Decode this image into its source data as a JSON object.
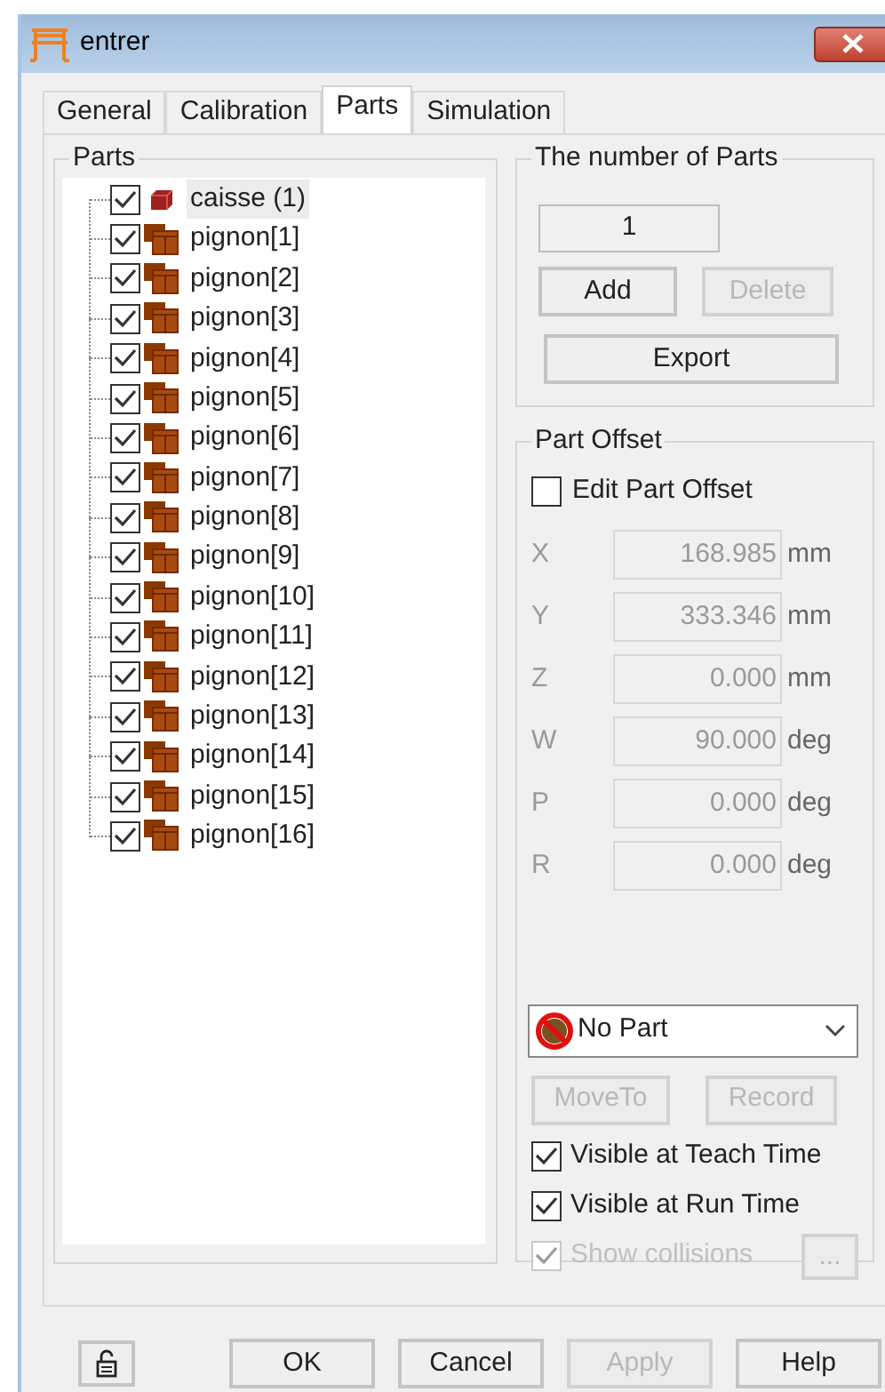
{
  "window": {
    "title": "entrer"
  },
  "tabs": [
    {
      "label": "General",
      "selected": false
    },
    {
      "label": "Calibration",
      "selected": false
    },
    {
      "label": "Parts",
      "selected": true
    },
    {
      "label": "Simulation",
      "selected": false
    }
  ],
  "parts_group": {
    "title": "Parts",
    "items": [
      {
        "label": "caisse (1)",
        "kind": "single",
        "checked": true,
        "selected": true
      },
      {
        "label": "pignon[1]",
        "kind": "multi",
        "checked": true,
        "selected": false
      },
      {
        "label": "pignon[2]",
        "kind": "multi",
        "checked": true,
        "selected": false
      },
      {
        "label": "pignon[3]",
        "kind": "multi",
        "checked": true,
        "selected": false
      },
      {
        "label": "pignon[4]",
        "kind": "multi",
        "checked": true,
        "selected": false
      },
      {
        "label": "pignon[5]",
        "kind": "multi",
        "checked": true,
        "selected": false
      },
      {
        "label": "pignon[6]",
        "kind": "multi",
        "checked": true,
        "selected": false
      },
      {
        "label": "pignon[7]",
        "kind": "multi",
        "checked": true,
        "selected": false
      },
      {
        "label": "pignon[8]",
        "kind": "multi",
        "checked": true,
        "selected": false
      },
      {
        "label": "pignon[9]",
        "kind": "multi",
        "checked": true,
        "selected": false
      },
      {
        "label": "pignon[10]",
        "kind": "multi",
        "checked": true,
        "selected": false
      },
      {
        "label": "pignon[11]",
        "kind": "multi",
        "checked": true,
        "selected": false
      },
      {
        "label": "pignon[12]",
        "kind": "multi",
        "checked": true,
        "selected": false
      },
      {
        "label": "pignon[13]",
        "kind": "multi",
        "checked": true,
        "selected": false
      },
      {
        "label": "pignon[14]",
        "kind": "multi",
        "checked": true,
        "selected": false
      },
      {
        "label": "pignon[15]",
        "kind": "multi",
        "checked": true,
        "selected": false
      },
      {
        "label": "pignon[16]",
        "kind": "multi",
        "checked": true,
        "selected": false
      }
    ]
  },
  "count_group": {
    "title": "The number of Parts",
    "count": "1",
    "add": {
      "label": "Add",
      "disabled": false
    },
    "delete": {
      "label": "Delete",
      "disabled": true
    },
    "export": {
      "label": "Export",
      "disabled": false
    }
  },
  "offset_group": {
    "title": "Part Offset",
    "edit": {
      "label": "Edit Part Offset",
      "checked": false
    },
    "fields": [
      {
        "axis": "X",
        "value": "168.985",
        "unit": "mm"
      },
      {
        "axis": "Y",
        "value": "333.346",
        "unit": "mm"
      },
      {
        "axis": "Z",
        "value": "0.000",
        "unit": "mm"
      },
      {
        "axis": "W",
        "value": "90.000",
        "unit": "deg"
      },
      {
        "axis": "P",
        "value": "0.000",
        "unit": "deg"
      },
      {
        "axis": "R",
        "value": "0.000",
        "unit": "deg"
      }
    ],
    "part_select": {
      "value": "No Part"
    },
    "move_to": {
      "label": "MoveTo",
      "disabled": true
    },
    "record": {
      "label": "Record",
      "disabled": true
    },
    "options": [
      {
        "label": "Visible at Teach Time",
        "checked": true,
        "disabled": false
      },
      {
        "label": "Visible at Run Time",
        "checked": true,
        "disabled": false
      },
      {
        "label": "Show collisions",
        "checked": true,
        "disabled": true
      }
    ],
    "more": {
      "label": "...",
      "disabled": true
    }
  },
  "footer": {
    "buttons": [
      {
        "label": "OK",
        "disabled": false
      },
      {
        "label": "Cancel",
        "disabled": false
      },
      {
        "label": "Apply",
        "disabled": true
      },
      {
        "label": "Help",
        "disabled": false
      }
    ]
  }
}
